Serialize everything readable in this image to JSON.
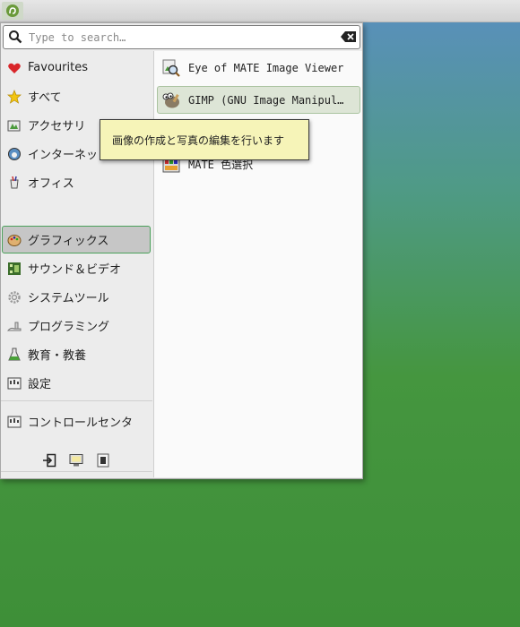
{
  "search": {
    "placeholder": "Type to search…"
  },
  "categories": [
    {
      "label": "Favourites"
    },
    {
      "label": "すべて"
    },
    {
      "label": "アクセサリ"
    },
    {
      "label": "インターネット"
    },
    {
      "label": "オフィス"
    },
    {
      "label": "グラフィックス"
    },
    {
      "label": "サウンド＆ビデオ"
    },
    {
      "label": "システムツール"
    },
    {
      "label": "プログラミング"
    },
    {
      "label": "教育・教養"
    },
    {
      "label": "設定"
    },
    {
      "label": "コントロールセンタ"
    }
  ],
  "active_category": "グラフィックス",
  "apps": [
    {
      "label": "Eye of MATE Image Viewer"
    },
    {
      "label": "GIMP (GNU Image Manipul…"
    },
    {
      "label": "MATE 色選択"
    }
  ],
  "tooltip": {
    "text": "画像の作成と写真の編集を行います"
  },
  "colors": {
    "accent": "#4aa05a",
    "tooltip_bg": "#f6f4b8"
  }
}
